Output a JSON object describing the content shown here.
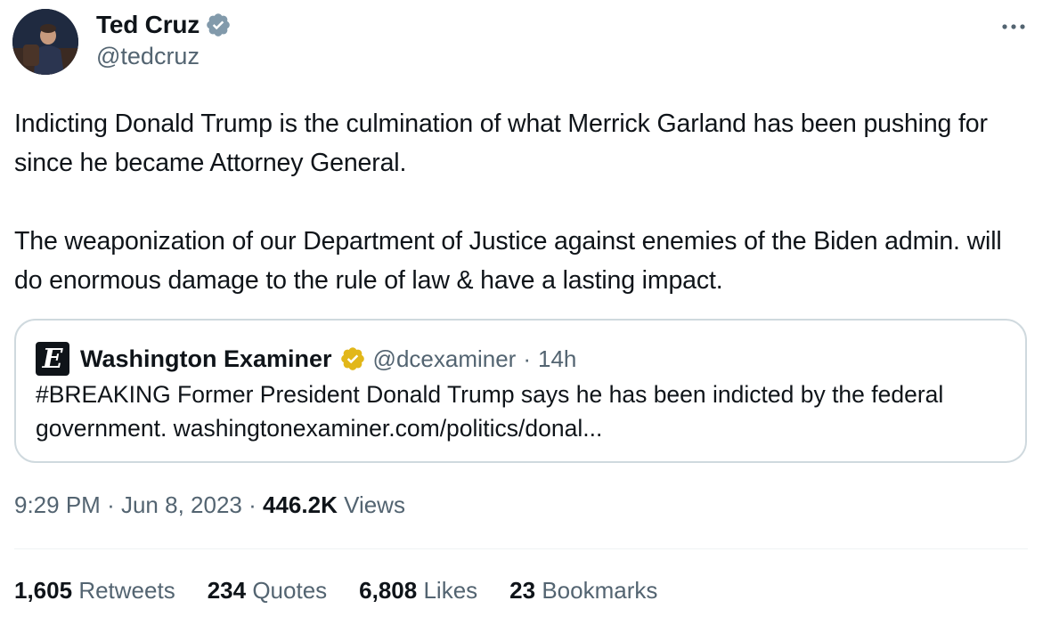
{
  "author": {
    "display_name": "Ted Cruz",
    "handle": "@tedcruz",
    "verified_badge_color": "#829aab",
    "avatar_icon": "profile-photo"
  },
  "more_icon": "more-horizontal-icon",
  "tweet": {
    "paragraph_1": "Indicting Donald Trump is the culmination of what Merrick Garland has been pushing for since he became Attorney General.",
    "paragraph_2": "The weaponization of our Department of Justice against enemies of the Biden admin. will do enormous damage to the rule of law & have a lasting impact."
  },
  "quote": {
    "logo_letter": "E",
    "name": "Washington Examiner",
    "verified_badge_color": "#e2b719",
    "handle": "@dcexaminer",
    "separator": "·",
    "time": "14h",
    "text": "#BREAKING Former President Donald Trump says he has been indicted by the federal government. ",
    "link": "washingtonexaminer.com/politics/donal..."
  },
  "meta": {
    "time": "9:29 PM",
    "separator": "·",
    "date": "Jun 8, 2023",
    "views_count": "446.2K",
    "views_label": "Views"
  },
  "stats": [
    {
      "count": "1,605",
      "label": "Retweets"
    },
    {
      "count": "234",
      "label": "Quotes"
    },
    {
      "count": "6,808",
      "label": "Likes"
    },
    {
      "count": "23",
      "label": "Bookmarks"
    }
  ]
}
